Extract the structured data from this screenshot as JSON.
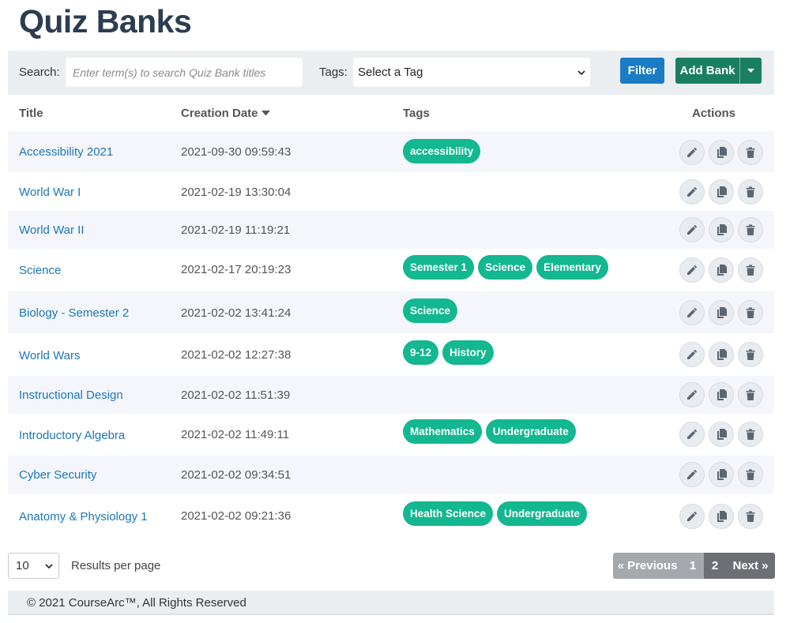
{
  "page": {
    "title": "Quiz Banks"
  },
  "toolbar": {
    "search_label": "Search:",
    "search_placeholder": "Enter term(s) to search Quiz Bank titles",
    "tags_label": "Tags:",
    "tags_selected": "Select a Tag",
    "filter_label": "Filter",
    "add_label": "Add Bank"
  },
  "table": {
    "headers": {
      "title": "Title",
      "date": "Creation Date",
      "tags": "Tags",
      "actions": "Actions"
    },
    "rows": [
      {
        "title": "Accessibility 2021",
        "date": "2021-09-30 09:59:43",
        "tags": [
          "accessibility"
        ]
      },
      {
        "title": "World War I",
        "date": "2021-02-19 13:30:04",
        "tags": []
      },
      {
        "title": "World War II",
        "date": "2021-02-19 11:19:21",
        "tags": []
      },
      {
        "title": "Science",
        "date": "2021-02-17 20:19:23",
        "tags": [
          "Semester 1",
          "Science",
          "Elementary"
        ]
      },
      {
        "title": "Biology - Semester 2",
        "date": "2021-02-02 13:41:24",
        "tags": [
          "Science"
        ]
      },
      {
        "title": "World Wars",
        "date": "2021-02-02 12:27:38",
        "tags": [
          "9-12",
          "History"
        ]
      },
      {
        "title": "Instructional Design",
        "date": "2021-02-02 11:51:39",
        "tags": []
      },
      {
        "title": "Introductory Algebra",
        "date": "2021-02-02 11:49:11",
        "tags": [
          "Mathematics",
          "Undergraduate"
        ]
      },
      {
        "title": "Cyber Security",
        "date": "2021-02-02 09:34:51",
        "tags": []
      },
      {
        "title": "Anatomy & Physiology 1",
        "date": "2021-02-02 09:21:36",
        "tags": [
          "Health Science",
          "Undergraduate"
        ]
      }
    ]
  },
  "pagination": {
    "per_page_value": "10",
    "per_page_label": "Results per page",
    "prev_label": "« Previous",
    "pages": [
      "1",
      "2"
    ],
    "current_page": "2",
    "next_label": "Next »"
  },
  "footer": {
    "text": "© 2021 CourseArc™, All Rights Reserved"
  },
  "colors": {
    "title": "#2b3d50",
    "link": "#1c77ba",
    "tag": "#13b790",
    "filter": "#1a7cc4",
    "add": "#1a7f5f"
  }
}
